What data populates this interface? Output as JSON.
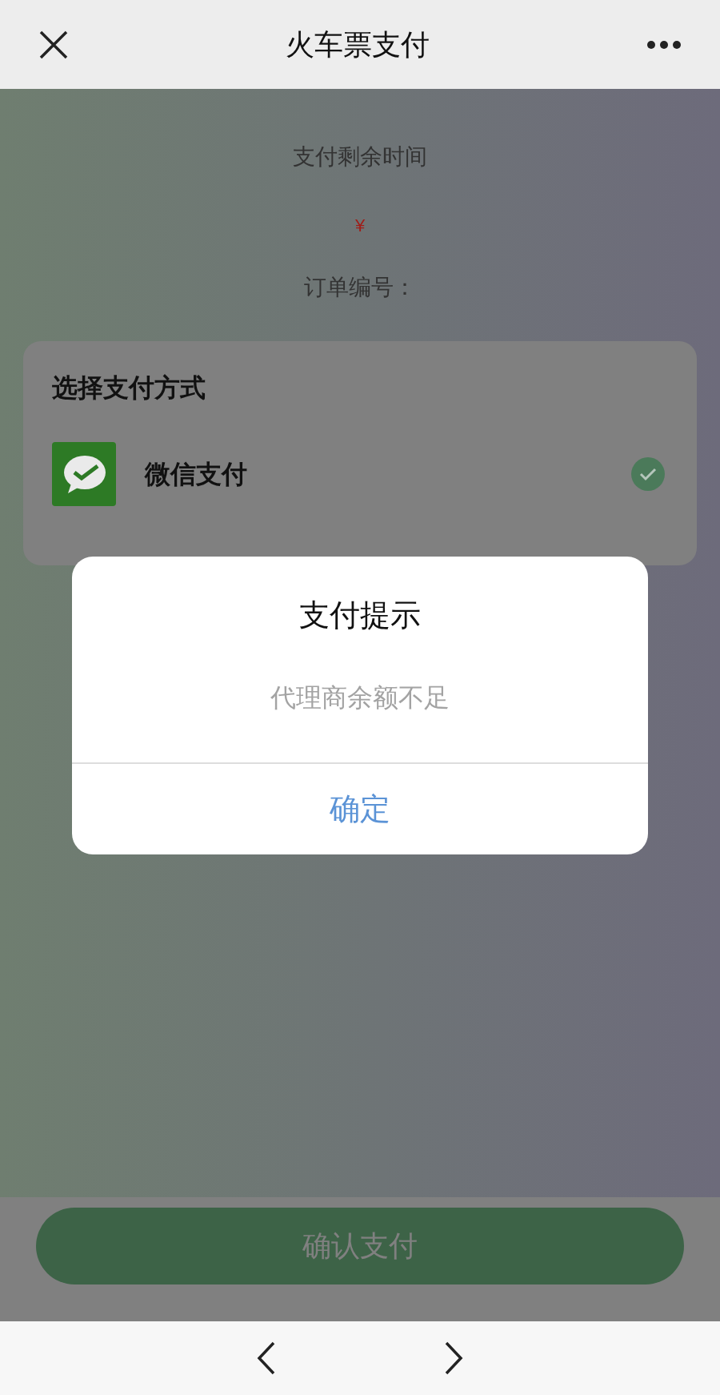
{
  "header": {
    "title": "火车票支付"
  },
  "summary": {
    "timer_label": "支付剩余时间",
    "amount": "¥",
    "order_label": "订单编号："
  },
  "payment": {
    "title": "选择支付方式",
    "methods": [
      {
        "name": "微信支付",
        "selected": true
      }
    ]
  },
  "confirm_button": "确认支付",
  "dialog": {
    "title": "支付提示",
    "message": "代理商余额不足",
    "button": "确定"
  }
}
